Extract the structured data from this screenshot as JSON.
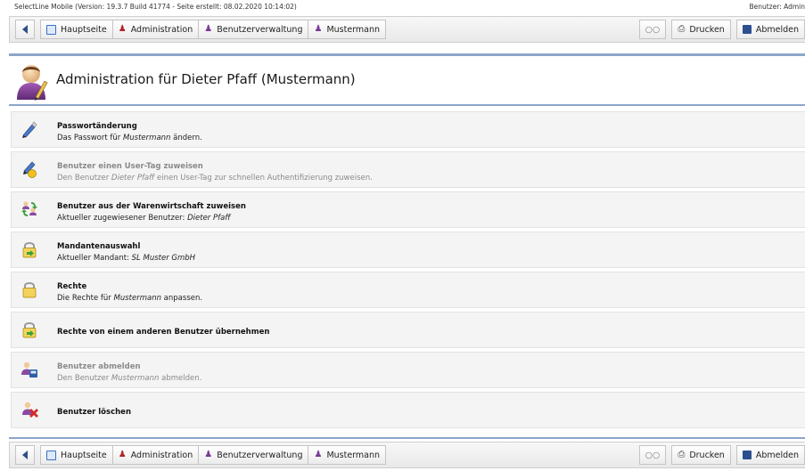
{
  "topline": {
    "version": "SelectLine Mobile (Version: 19.3.7 Build 41774 - Seite erstellt: 08.02.2020 10:14:02)",
    "user": "Benutzer: Admin"
  },
  "nav": {
    "back_icon": "back-arrow-icon",
    "crumbs": [
      {
        "label": "Hauptseite",
        "icon": "home-icon"
      },
      {
        "label": "Administration",
        "icon": "person-icon"
      },
      {
        "label": "Benutzerverwaltung",
        "icon": "person-icon"
      },
      {
        "label": "Mustermann",
        "icon": "user-edit-icon"
      }
    ],
    "print_label": "Drucken",
    "logout_label": "Abmelden"
  },
  "page": {
    "title": "Administration für Dieter Pfaff (Mustermann)"
  },
  "items": [
    {
      "title": "Passwortänderung",
      "desc_pre": "Das Passwort für ",
      "desc_em": "Mustermann",
      "desc_post": " ändern.",
      "icon": "pen-icon",
      "disabled": false
    },
    {
      "title": "Benutzer einen User-Tag zuweisen",
      "desc_pre": "Den Benutzer ",
      "desc_em": "Dieter Pfaff",
      "desc_post": " einen User-Tag zur schnellen Authentifizierung zuweisen.",
      "icon": "pen-tag-icon",
      "disabled": true
    },
    {
      "title": "Benutzer aus der Warenwirtschaft zuweisen",
      "desc_pre": "Aktueller zugewiesener Benutzer: ",
      "desc_em": "Dieter Pfaff",
      "desc_post": "",
      "icon": "users-sync-icon",
      "disabled": false
    },
    {
      "title": "Mandantenauswahl",
      "desc_pre": "Aktueller Mandant: ",
      "desc_em": "SL Muster GmbH",
      "desc_post": "",
      "icon": "lock-green-icon",
      "disabled": false
    },
    {
      "title": "Rechte",
      "desc_pre": "Die Rechte für ",
      "desc_em": "Mustermann",
      "desc_post": " anpassen.",
      "icon": "lock-icon",
      "disabled": false
    },
    {
      "title": "Rechte von einem anderen Benutzer übernehmen",
      "desc_pre": "",
      "desc_em": "",
      "desc_post": "",
      "icon": "lock-arrow-icon",
      "disabled": false
    },
    {
      "title": "Benutzer abmelden",
      "desc_pre": "Den Benutzer ",
      "desc_em": "Mustermann",
      "desc_post": " abmelden.",
      "icon": "user-logout-icon",
      "disabled": true
    },
    {
      "title": "Benutzer löschen",
      "desc_pre": "",
      "desc_em": "",
      "desc_post": "",
      "icon": "user-delete-icon",
      "disabled": false
    }
  ]
}
